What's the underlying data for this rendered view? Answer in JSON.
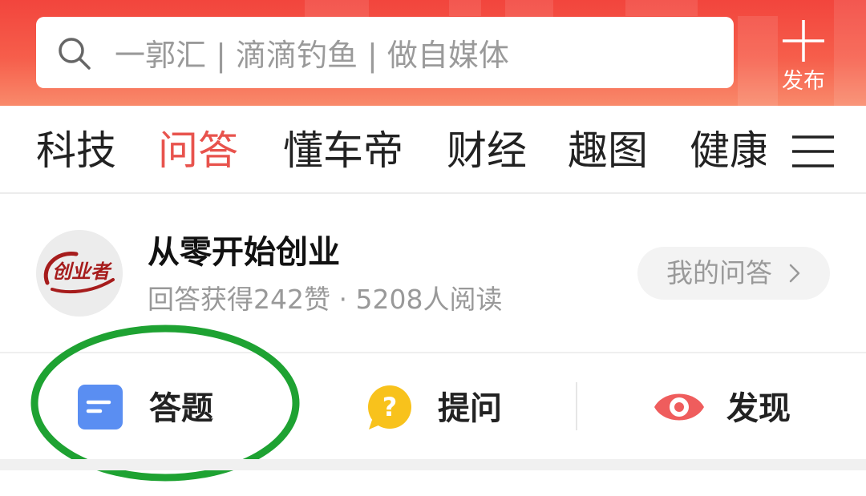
{
  "header": {
    "search": {
      "placeholder": "一郭汇 | 滴滴钓鱼 | 做自媒体",
      "icon": "search-icon"
    },
    "publish": {
      "label": "发布",
      "icon": "plus-icon"
    },
    "colors": {
      "gradient_top": "#f2453d",
      "gradient_bottom": "#f98a6b"
    }
  },
  "tabs": {
    "items": [
      {
        "label": "科技",
        "active": false
      },
      {
        "label": "问答",
        "active": true
      },
      {
        "label": "懂车帝",
        "active": false
      },
      {
        "label": "财经",
        "active": false
      },
      {
        "label": "趣图",
        "active": false
      },
      {
        "label": "健康",
        "active": false
      }
    ],
    "menu_icon": "hamburger-menu-icon",
    "active_color": "#e8534d"
  },
  "profile": {
    "avatar_text": "创业者",
    "name": "从零开始创业",
    "stats": "回答获得242赞 · 5208人阅读",
    "my_qa_button": "我的问答",
    "my_qa_icon": "chevron-right-icon"
  },
  "actions": [
    {
      "label": "答题",
      "icon": "answer-doc-icon",
      "color": "#5a8ef2"
    },
    {
      "label": "提问",
      "icon": "question-bubble-icon",
      "color": "#f8c21c"
    },
    {
      "label": "发现",
      "icon": "eye-icon",
      "color": "#ef5d5d"
    }
  ],
  "annotation": {
    "shape": "ellipse",
    "color": "#1ea232",
    "around": "答题"
  }
}
